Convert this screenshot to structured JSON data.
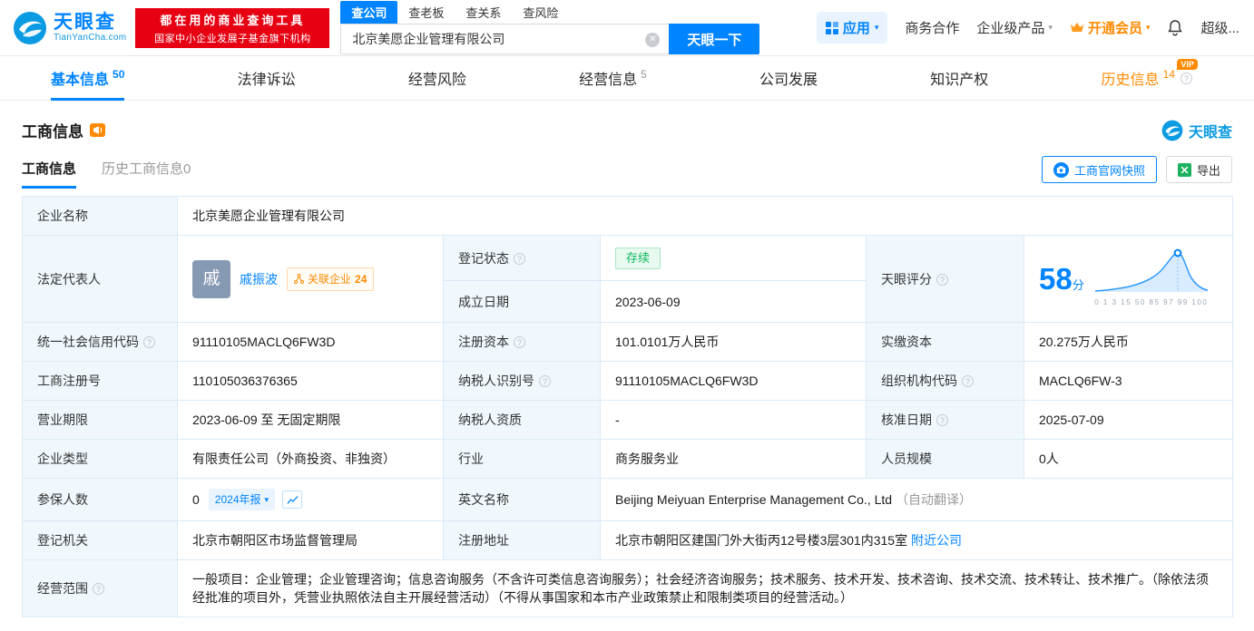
{
  "header": {
    "logo": {
      "name": "天眼查",
      "domain": "TianYanCha.com"
    },
    "promo": {
      "line1": "都在用的商业查询工具",
      "line2": "国家中小企业发展子基金旗下机构"
    },
    "search": {
      "tabs": [
        "查公司",
        "查老板",
        "查关系",
        "查风险"
      ],
      "value": "北京美愿企业管理有限公司",
      "button": "天眼一下"
    },
    "nav": {
      "apps": "应用",
      "cooperation": "商务合作",
      "enterprise": "企业级产品",
      "vip": "开通会员",
      "user": "超级..."
    }
  },
  "tabs": [
    {
      "label": "基本信息",
      "count": "50"
    },
    {
      "label": "法律诉讼"
    },
    {
      "label": "经营风险"
    },
    {
      "label": "经营信息",
      "count": "5"
    },
    {
      "label": "公司发展"
    },
    {
      "label": "知识产权"
    },
    {
      "label": "历史信息",
      "count": "14",
      "vip": "VIP"
    }
  ],
  "section": {
    "title": "工商信息",
    "brand": "天眼查",
    "subtabs": [
      "工商信息",
      "历史工商信息0"
    ],
    "snapshot_button": "工商官网快照",
    "export_button": "导出"
  },
  "info": {
    "company_name": {
      "label": "企业名称",
      "value": "北京美愿企业管理有限公司"
    },
    "legal_rep": {
      "label": "法定代表人",
      "avatar": "戚",
      "name": "戚振波",
      "related_label": "关联企业",
      "related_count": "24"
    },
    "reg_status": {
      "label": "登记状态",
      "value": "存续"
    },
    "establish_date": {
      "label": "成立日期",
      "value": "2023-06-09"
    },
    "score": {
      "label": "天眼评分",
      "value": "58",
      "unit": "分",
      "axis": "0 1 3 15 50 85 97 99 100"
    },
    "credit_code": {
      "label": "统一社会信用代码",
      "value": "91110105MACLQ6FW3D"
    },
    "reg_capital": {
      "label": "注册资本",
      "value": "101.0101万人民币"
    },
    "paid_capital": {
      "label": "实缴资本",
      "value": "20.275万人民币"
    },
    "reg_no": {
      "label": "工商注册号",
      "value": "110105036376365"
    },
    "taxpayer_no": {
      "label": "纳税人识别号",
      "value": "91110105MACLQ6FW3D"
    },
    "org_code": {
      "label": "组织机构代码",
      "value": "MACLQ6FW-3"
    },
    "term": {
      "label": "营业期限",
      "value": "2023-06-09 至 无固定期限"
    },
    "taxpayer_quality": {
      "label": "纳税人资质",
      "value": "-"
    },
    "approve_date": {
      "label": "核准日期",
      "value": "2025-07-09"
    },
    "company_type": {
      "label": "企业类型",
      "value": "有限责任公司（外商投资、非独资）"
    },
    "industry": {
      "label": "行业",
      "value": "商务服务业"
    },
    "staff_size": {
      "label": "人员规模",
      "value": "0人"
    },
    "insured": {
      "label": "参保人数",
      "value": "0",
      "report": "2024年报"
    },
    "english_name": {
      "label": "英文名称",
      "value": "Beijing Meiyuan Enterprise Management Co., Ltd",
      "note": "（自动翻译）"
    },
    "authority": {
      "label": "登记机关",
      "value": "北京市朝阳区市场监督管理局"
    },
    "address": {
      "label": "注册地址",
      "value": "北京市朝阳区建国门外大街丙12号楼3层301内315室",
      "nearby": "附近公司"
    },
    "scope": {
      "label": "经营范围",
      "value": "一般项目：企业管理；企业管理咨询；信息咨询服务（不含许可类信息咨询服务）；社会经济咨询服务；技术服务、技术开发、技术咨询、技术交流、技术转让、技术推广。（除依法须经批准的项目外，凭营业执照依法自主开展经营活动）（不得从事国家和本市产业政策禁止和限制类项目的经营活动。）"
    }
  },
  "colors": {
    "accent": "#0084ff",
    "orange": "#ff8a00",
    "green": "#0cb95f",
    "red": "#e60012"
  }
}
